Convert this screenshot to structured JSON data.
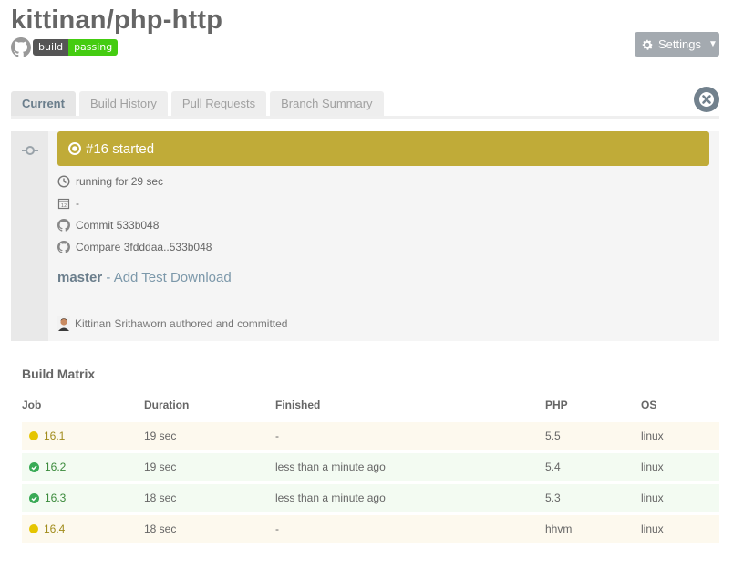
{
  "repo": {
    "title": "kittinan/php-http",
    "badge_left": "build",
    "badge_right": "passing"
  },
  "settings": {
    "label": "Settings",
    "caret": "▼"
  },
  "tabs": [
    {
      "label": "Current"
    },
    {
      "label": "Build History"
    },
    {
      "label": "Pull Requests"
    },
    {
      "label": "Branch Summary"
    }
  ],
  "build": {
    "status_text": "#16 started",
    "running": "running for 29 sec",
    "date": "-",
    "commit": "Commit 533b048",
    "compare": "Compare 3fdddaa..533b048",
    "branch": "master",
    "message": "- Add Test Download",
    "author": "Kittinan Srithaworn authored and committed"
  },
  "matrix": {
    "title": "Build Matrix",
    "headers": {
      "job": "Job",
      "duration": "Duration",
      "finished": "Finished",
      "php": "PHP",
      "os": "OS"
    },
    "rows": [
      {
        "job": "16.1",
        "duration": "19 sec",
        "finished": "-",
        "php": "5.5",
        "os": "linux",
        "state": "started"
      },
      {
        "job": "16.2",
        "duration": "19 sec",
        "finished": "less than a minute ago",
        "php": "5.4",
        "os": "linux",
        "state": "passed"
      },
      {
        "job": "16.3",
        "duration": "18 sec",
        "finished": "less than a minute ago",
        "php": "5.3",
        "os": "linux",
        "state": "passed"
      },
      {
        "job": "16.4",
        "duration": "18 sec",
        "finished": "-",
        "php": "hhvm",
        "os": "linux",
        "state": "started"
      }
    ]
  },
  "colors": {
    "started": "#c0ab38",
    "passed": "#39aa56",
    "badge_passing": "#4c1"
  }
}
